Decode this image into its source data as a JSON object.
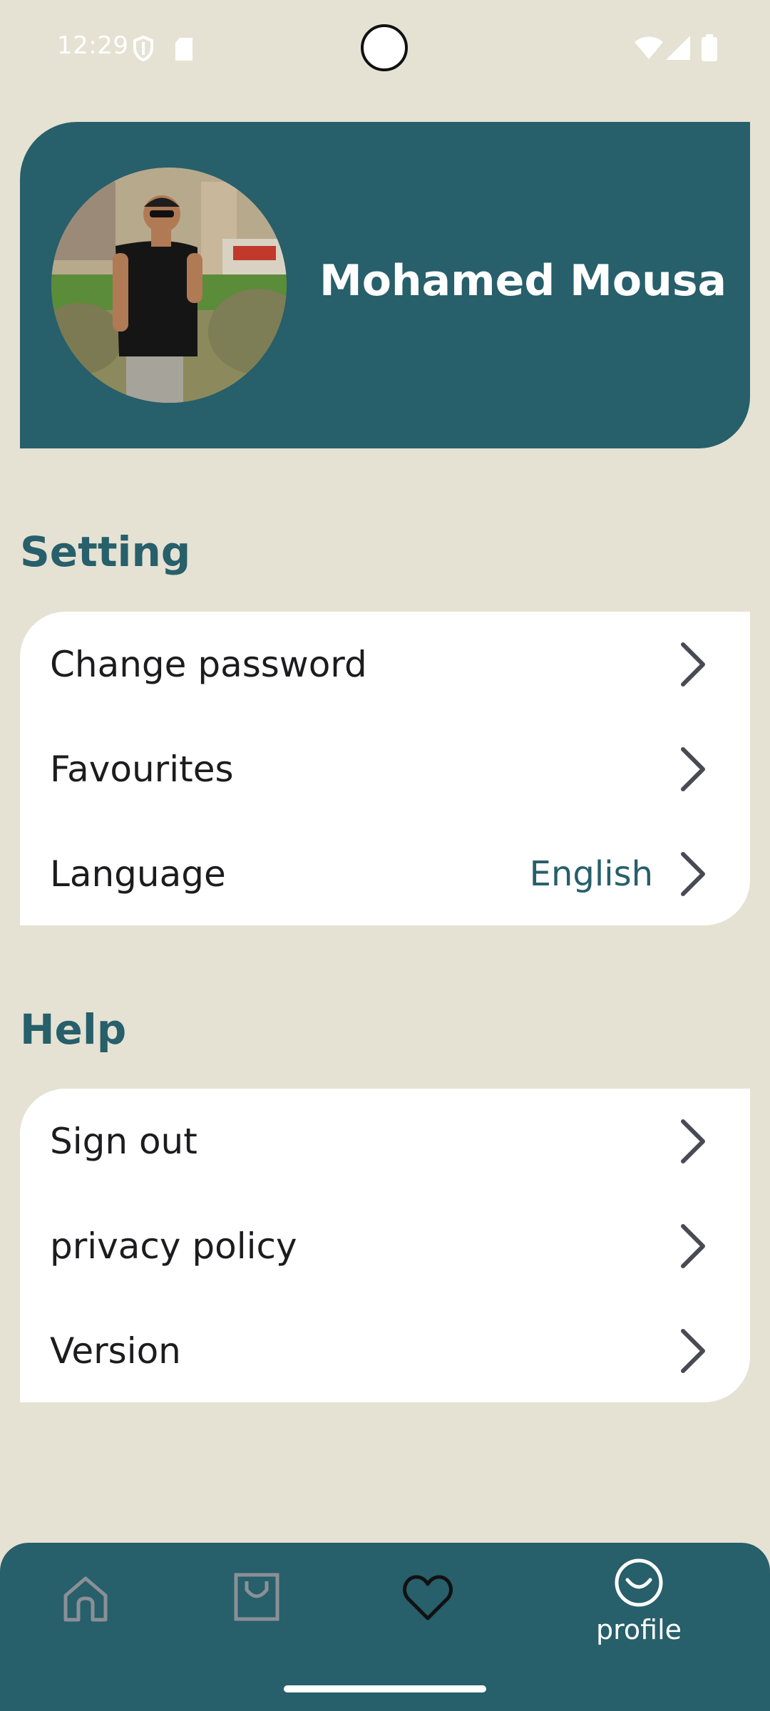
{
  "status_bar": {
    "time": "12:29",
    "icons": [
      "shield-icon",
      "sd-card-icon",
      "wifi-icon",
      "signal-icon",
      "battery-icon"
    ]
  },
  "profile": {
    "name": "Mohamed Mousa",
    "avatar_icon": "profile-photo"
  },
  "settings": {
    "title": "Setting",
    "items": [
      {
        "label": "Change password",
        "value": ""
      },
      {
        "label": "Favourites",
        "value": ""
      },
      {
        "label": "Language",
        "value": "English"
      }
    ]
  },
  "help": {
    "title": "Help",
    "items": [
      {
        "label": "Sign out"
      },
      {
        "label": "privacy policy"
      },
      {
        "label": "Version"
      }
    ]
  },
  "bottom_nav": {
    "items": [
      {
        "icon": "home-icon",
        "label": ""
      },
      {
        "icon": "shopping-bag-icon",
        "label": ""
      },
      {
        "icon": "heart-icon",
        "label": ""
      },
      {
        "icon": "smile-icon",
        "label": "profile"
      }
    ],
    "active": "profile"
  },
  "colors": {
    "background": "#e5e2d3",
    "primary": "#275f6b",
    "card": "#ffffff",
    "chevron": "#4a4a55"
  }
}
